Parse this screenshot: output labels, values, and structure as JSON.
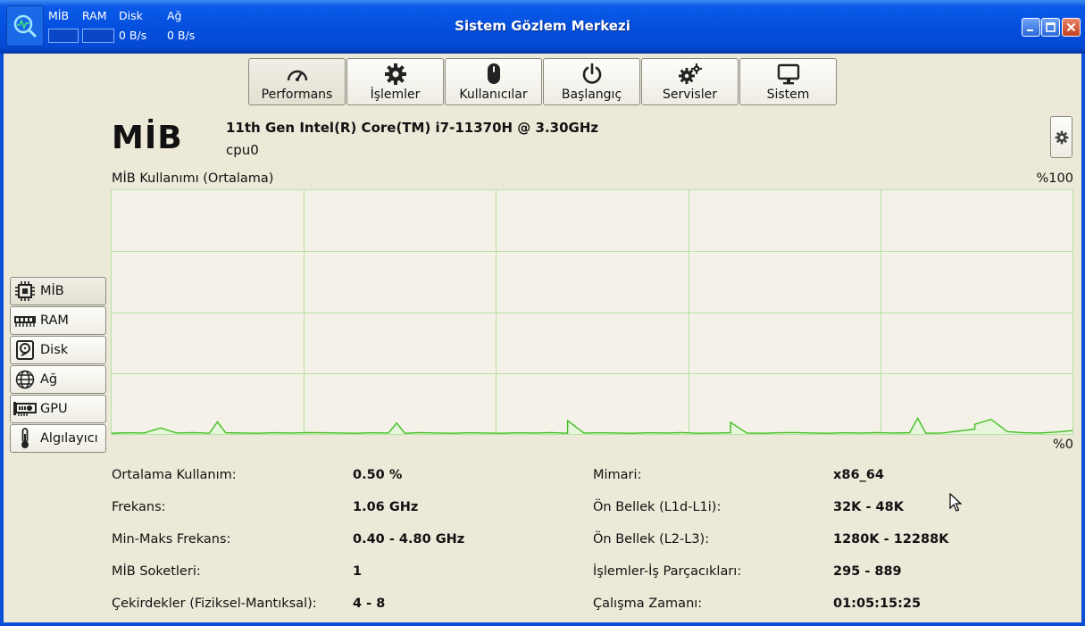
{
  "window": {
    "title": "Sistem Gözlem Merkezi",
    "mini": {
      "cpu_label": "MİB",
      "ram_label": "RAM",
      "disk_label": "Disk",
      "net_label": "Ağ",
      "disk_value": "0 B/s",
      "net_value": "0 B/s"
    }
  },
  "toolbar": [
    {
      "label": "Performans",
      "icon": "gauge-icon"
    },
    {
      "label": "İşlemler",
      "icon": "gear-icon"
    },
    {
      "label": "Kullanıcılar",
      "icon": "mouse-icon"
    },
    {
      "label": "Başlangıç",
      "icon": "power-icon"
    },
    {
      "label": "Servisler",
      "icon": "gears-icon"
    },
    {
      "label": "Sistem",
      "icon": "monitor-icon"
    }
  ],
  "header": {
    "title": "MİB",
    "cpu_model": "11th Gen Intel(R) Core(TM) i7-11370H @ 3.30GHz",
    "cpu_id": "cpu0"
  },
  "side": [
    {
      "label": "MİB",
      "icon": "cpu-chip-icon"
    },
    {
      "label": "RAM",
      "icon": "ram-icon"
    },
    {
      "label": "Disk",
      "icon": "disk-icon"
    },
    {
      "label": "Ağ",
      "icon": "globe-icon"
    },
    {
      "label": "GPU",
      "icon": "gpu-icon"
    },
    {
      "label": "Algılayıcı",
      "icon": "thermometer-icon"
    }
  ],
  "chart_data": {
    "type": "area",
    "title": "MİB Kullanımı (Ortalama)",
    "max_label": "%100",
    "min_label": "%0",
    "ylim": [
      0,
      100
    ],
    "grid": true,
    "colors": {
      "line": "#3fbf1f",
      "grid": "#b7e0a3",
      "fill": "#e6f5dc"
    },
    "x": [
      0,
      1,
      2,
      3,
      4,
      5,
      6,
      7,
      8,
      9,
      10,
      11,
      12,
      13,
      14,
      15,
      16,
      17,
      18,
      19,
      20,
      21,
      22,
      23,
      24,
      25,
      26,
      27,
      28,
      29,
      30,
      31,
      32,
      33,
      34,
      35,
      36,
      37,
      38,
      39,
      40,
      41,
      42,
      43,
      44,
      45,
      46,
      47,
      48,
      49,
      50,
      51,
      52,
      53,
      54,
      55,
      56,
      57,
      58,
      59
    ],
    "values": [
      0.3,
      0.5,
      0.4,
      2.5,
      0.4,
      0.6,
      0.3,
      0.5,
      0.4,
      0.3,
      0.5,
      0.4,
      0.6,
      0.5,
      0.4,
      0.3,
      0.5,
      0.4,
      0.3,
      0.6,
      0.4,
      0.3,
      0.5,
      0.4,
      0.3,
      0.5,
      0.4,
      0.6,
      0.3,
      0.4,
      0.5,
      0.4,
      0.3,
      0.5,
      0.4,
      0.6,
      0.3,
      0.4,
      0.5,
      0.4,
      0.3,
      0.5,
      0.6,
      0.4,
      0.3,
      0.5,
      0.4,
      0.6,
      0.4,
      0.5,
      0.3,
      0.4,
      1.2,
      2.0,
      6.0,
      1.0,
      0.5,
      0.4,
      0.8,
      1.4
    ],
    "spikes": [
      {
        "x": 3,
        "y": 2.5
      },
      {
        "x": 6.5,
        "y": 5.0
      },
      {
        "x": 17.5,
        "y": 4.5
      },
      {
        "x": 28.0,
        "y": 5.5
      },
      {
        "x": 38.0,
        "y": 4.8
      },
      {
        "x": 49.5,
        "y": 6.5
      },
      {
        "x": 53.0,
        "y": 4.0
      }
    ]
  },
  "stats_left": [
    {
      "label": "Ortalama Kullanım:",
      "value": "0.50 %"
    },
    {
      "label": "Frekans:",
      "value": "1.06 GHz"
    },
    {
      "label": "Min-Maks Frekans:",
      "value": "0.40 - 4.80 GHz"
    },
    {
      "label": "MİB Soketleri:",
      "value": "1"
    },
    {
      "label": "Çekirdekler (Fiziksel-Mantıksal):",
      "value": "4 - 8"
    }
  ],
  "stats_right": [
    {
      "label": "Mimari:",
      "value": "x86_64"
    },
    {
      "label": "Ön Bellek (L1d-L1i):",
      "value": "32K - 48K"
    },
    {
      "label": "Ön Bellek (L2-L3):",
      "value": "1280K - 12288K"
    },
    {
      "label": "İşlemler-İş Parçacıkları:",
      "value": "295 - 889"
    },
    {
      "label": "Çalışma Zamanı:",
      "value": "01:05:15:25"
    }
  ]
}
